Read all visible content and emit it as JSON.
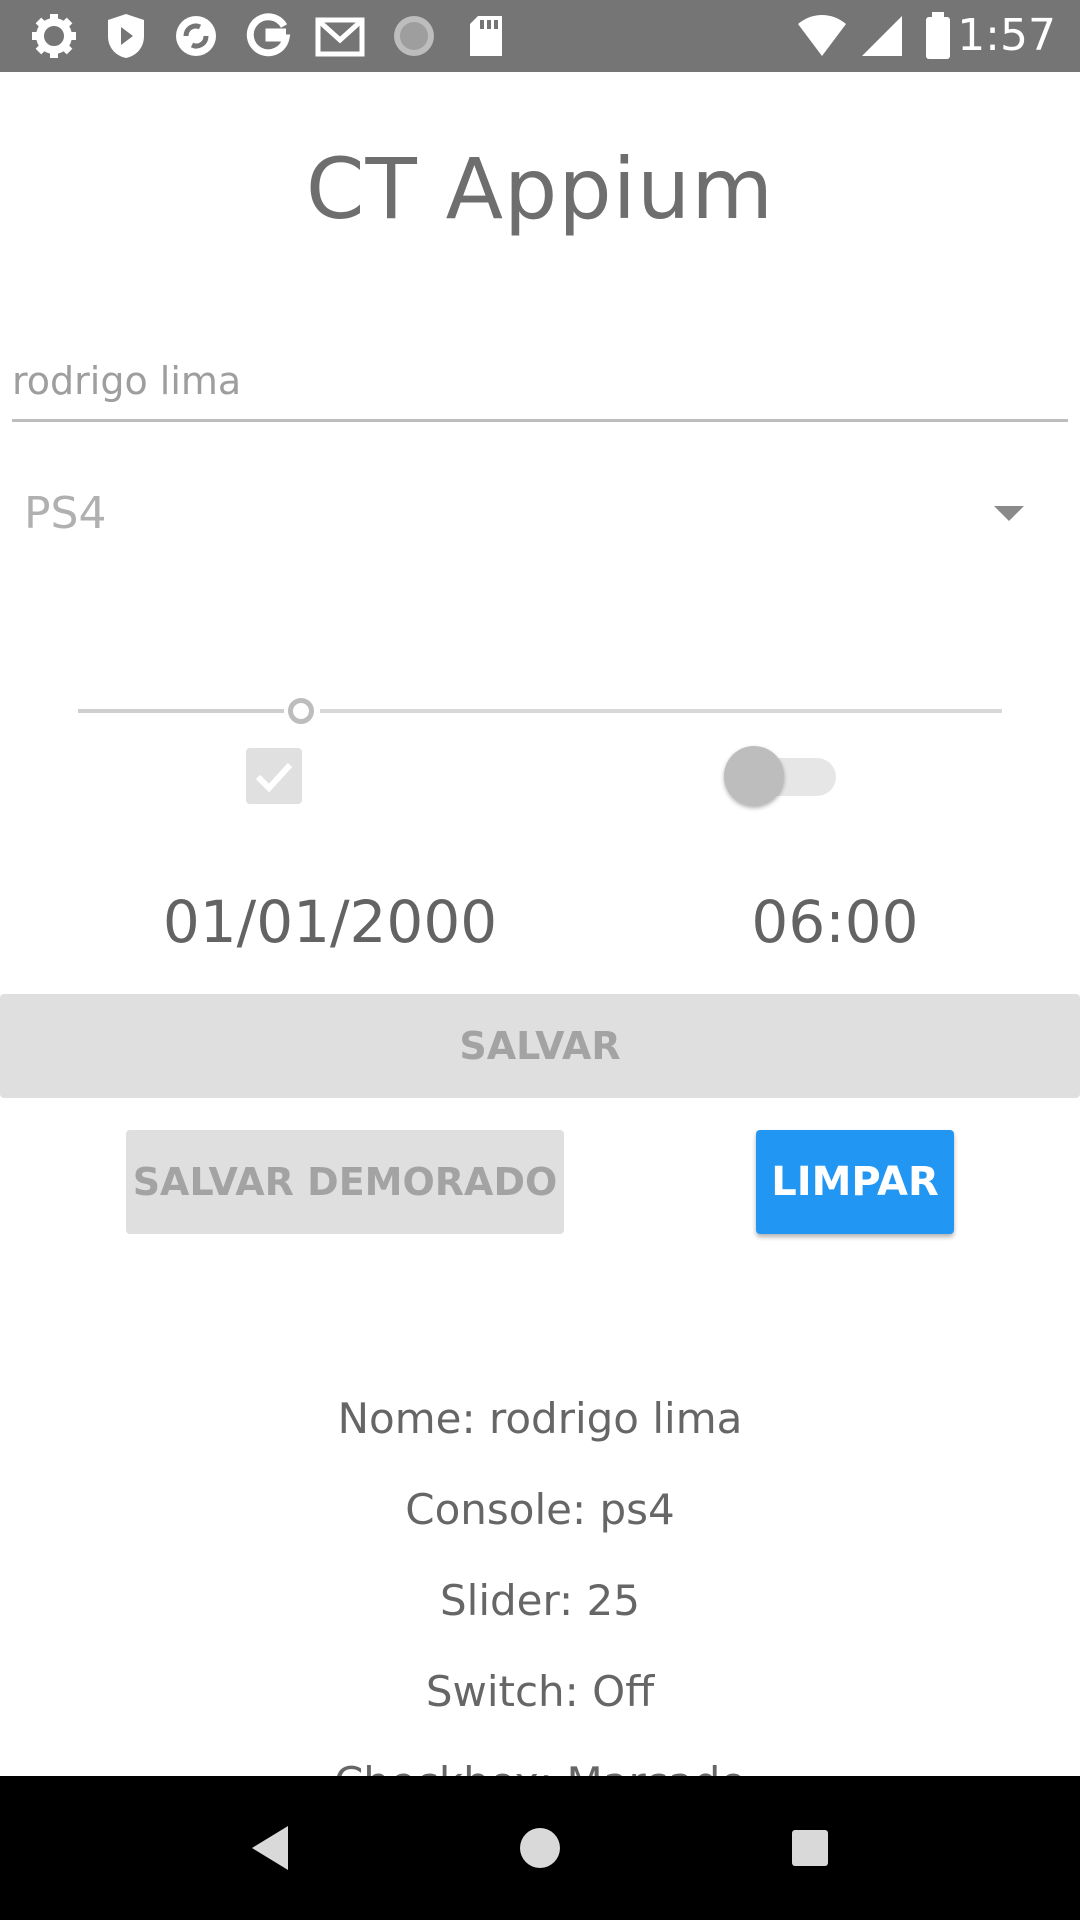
{
  "status_bar": {
    "time": "1:57",
    "left_icons": [
      "settings-icon",
      "shield-play-icon",
      "sync-icon",
      "google-icon",
      "gmail-icon",
      "loading-icon",
      "sd-card-icon"
    ],
    "right_icons": [
      "wifi-icon",
      "signal-icon",
      "battery-icon"
    ]
  },
  "app": {
    "title": "CT Appium"
  },
  "form": {
    "name_value": "rodrigo lima",
    "console_selected": "PS4",
    "slider_value": 25,
    "checkbox_checked": true,
    "switch_on": false,
    "date": "01/01/2000",
    "time": "06:00"
  },
  "buttons": {
    "save": "SALVAR",
    "save_delayed": "SALVAR DEMORADO",
    "clear": "LIMPAR"
  },
  "results": {
    "name": "Nome: rodrigo lima",
    "console": "Console: ps4",
    "slider": "Slider: 25",
    "switch": "Switch: Off",
    "checkbox": "Checkbox: Marcado"
  },
  "nav_bar": {
    "icons": [
      "back-icon",
      "home-icon",
      "recents-icon"
    ]
  },
  "colors": {
    "status_bar": "#757575",
    "accent": "#2196f3",
    "disabled_button": "#dfdfdf"
  }
}
